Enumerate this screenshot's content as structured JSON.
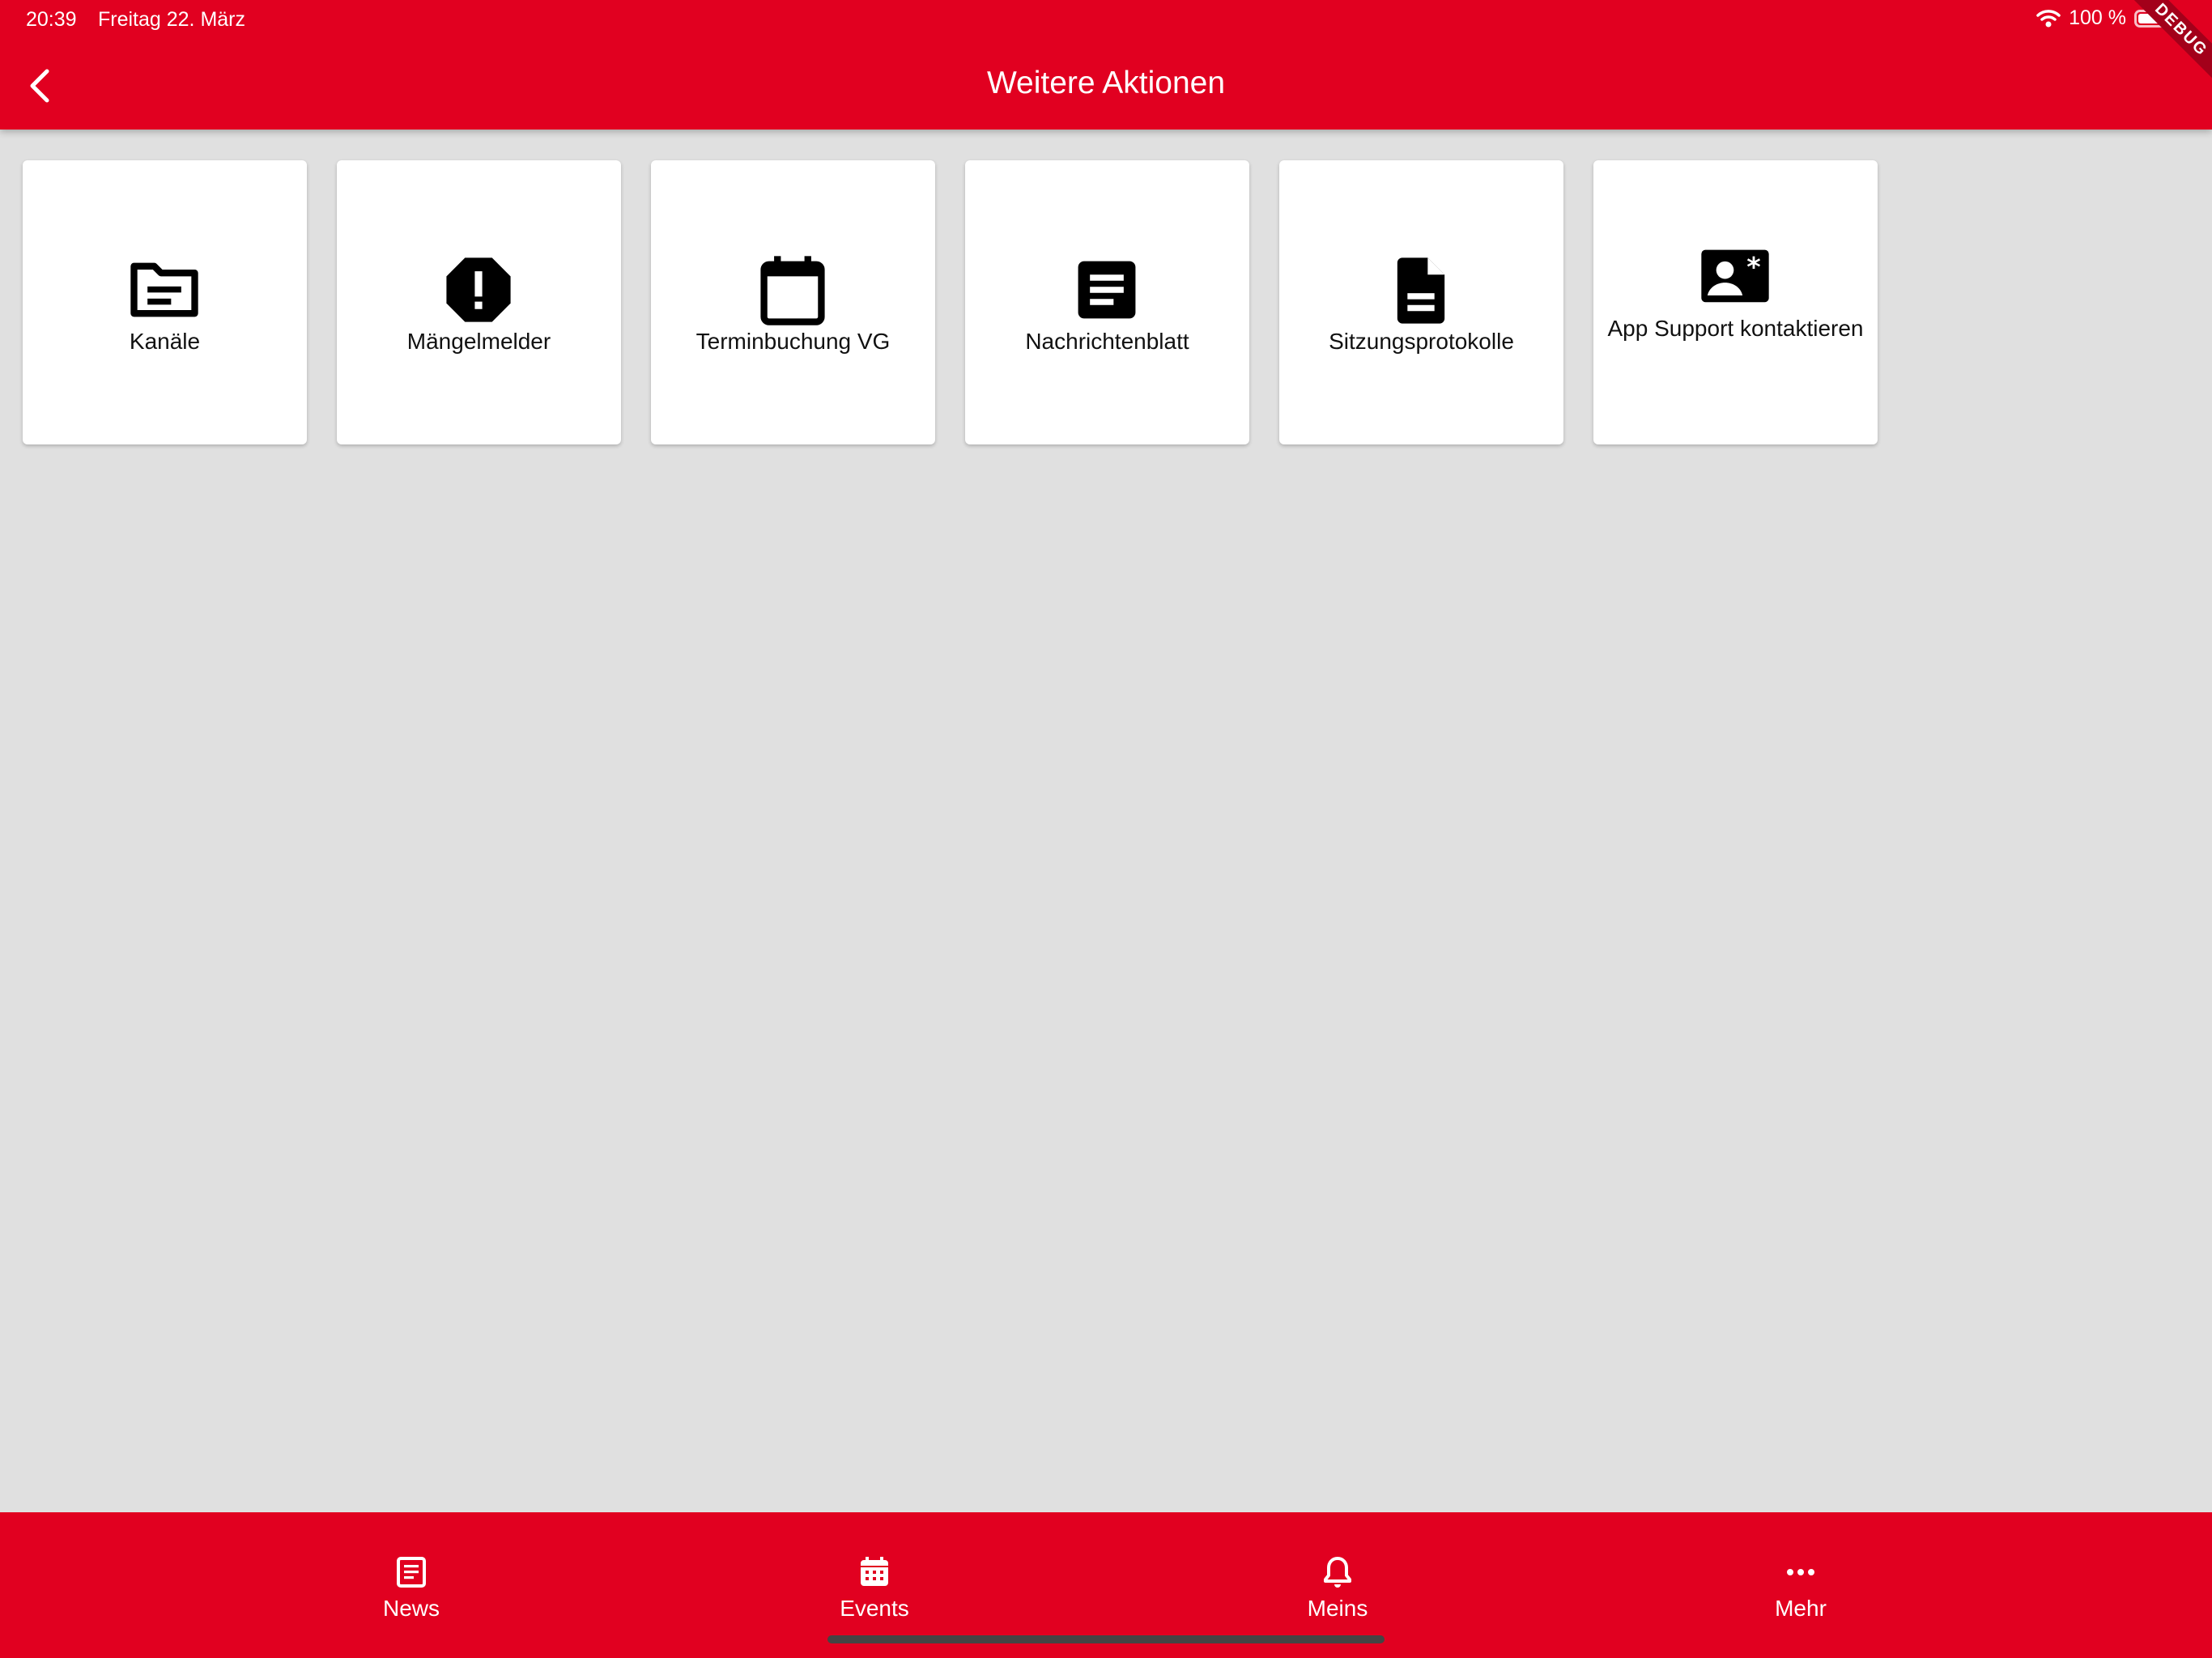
{
  "status_bar": {
    "time": "20:39",
    "date": "Freitag 22. März",
    "battery": "100 %"
  },
  "header": {
    "title": "Weitere Aktionen",
    "debug_banner": "DEBUG"
  },
  "tiles": [
    {
      "label": "Kanäle",
      "icon": "folder-document-icon"
    },
    {
      "label": "Mängelmelder",
      "icon": "alert-octagon-icon"
    },
    {
      "label": "Terminbuchung VG",
      "icon": "calendar-icon"
    },
    {
      "label": "Nachrichtenblatt",
      "icon": "article-icon"
    },
    {
      "label": "Sitzungsprotokolle",
      "icon": "document-icon"
    },
    {
      "label": "App Support kontaktieren",
      "icon": "contact-card-icon"
    }
  ],
  "bottom_nav": [
    {
      "label": "News",
      "icon": "newspaper-icon"
    },
    {
      "label": "Events",
      "icon": "calendar-grid-icon"
    },
    {
      "label": "Meins",
      "icon": "bell-icon"
    },
    {
      "label": "Mehr",
      "icon": "more-dots-icon"
    }
  ],
  "colors": {
    "accent": "#e10020",
    "background": "#e0e0e0",
    "tile": "#ffffff"
  }
}
